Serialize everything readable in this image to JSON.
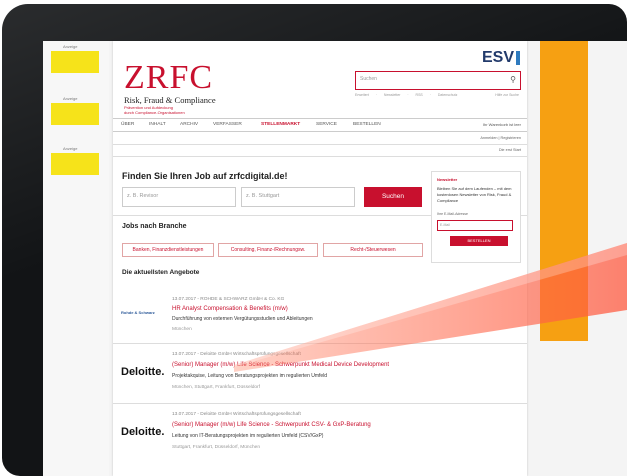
{
  "ads": {
    "label": "Anzeige"
  },
  "header": {
    "logo": "ZRFC",
    "subtitle": "Risk, Fraud & Compliance",
    "tagline_1": "Prävention und Aufdeckung",
    "tagline_2": "durch Compliance-Organisationen",
    "publisher": "ESV",
    "search_placeholder": "Suchen",
    "search_links": "Erweitert · Newsletter · RSS · Datenschutz",
    "search_links_right": "Hilfe zur Suche"
  },
  "nav": {
    "items": [
      "ÜBER",
      "INHALT",
      "ARCHIV",
      "VERFASSER",
      "STELLENMARKT",
      "SERVICE",
      "BESTELLEN"
    ],
    "active": "STELLENMARKT",
    "right": "Ihr Warenkorb ist leer",
    "login": "Anmelden | Registrieren",
    "subtitle": "Die erst Start"
  },
  "jobsearch": {
    "heading": "Finden Sie Ihren Job auf zrfcdigital.de!",
    "what_placeholder": "z. B. Revisor",
    "where_placeholder": "z. B. Stuttgart",
    "button": "Suchen"
  },
  "branche": {
    "heading": "Jobs nach Branche",
    "tags": [
      "Banken, Finanzdienstleistungen",
      "Consulting, Finanz-/Rechnungsw.",
      "Recht-/Steuerwesen"
    ]
  },
  "angebote": {
    "heading": "Die aktuellsten Angebote",
    "jobs": [
      {
        "logo": "Rohde & Schwarz",
        "date": "13.07.2017 - ROHDE & SCHWARZ GmbH & Co. KG",
        "title": "HR Analyst Compensation & Benefits (m/w)",
        "desc": "Durchführung von externen Vergütungsstudien und Ableitungen",
        "loc": "München"
      },
      {
        "logo": "Deloitte.",
        "date": "13.07.2017 - Deloitte GmbH Wirtschaftsprüfungsgesellschaft",
        "title": "(Senior) Manager (m/w) Life Science - Schwerpunkt Medical Device Development",
        "desc": "Projektakquise, Leitung von Beratungsprojekten im regulierten Umfeld",
        "loc": "München, Stuttgart, Frankfurt, Düsseldorf"
      },
      {
        "logo": "Deloitte.",
        "date": "13.07.2017 - Deloitte GmbH Wirtschaftsprüfungsgesellschaft",
        "title": "(Senior) Manager (m/w) Life Science - Schwerpunkt CSV- & GxP-Beratung",
        "desc": "Leitung von IT-Beratungsprojekten im regulierten Umfeld (CSV/GxP)",
        "loc": "Stuttgart, Frankfurt, Düsseldorf, München"
      }
    ]
  },
  "newsletter": {
    "title": "Newsletter",
    "text": "Bleiben Sie auf dem Laufenden – mit dem kostenlosen Newsletter von Risk, Fraud & Compliance",
    "label": "Ihre E-Mail-Adresse",
    "placeholder": "E-Mail",
    "button": "BESTELLEN"
  },
  "colors": {
    "brand": "#c8102e",
    "ad_yellow": "#f6e31a",
    "accent_orange": "#f6a012",
    "bezel": "#121416"
  }
}
